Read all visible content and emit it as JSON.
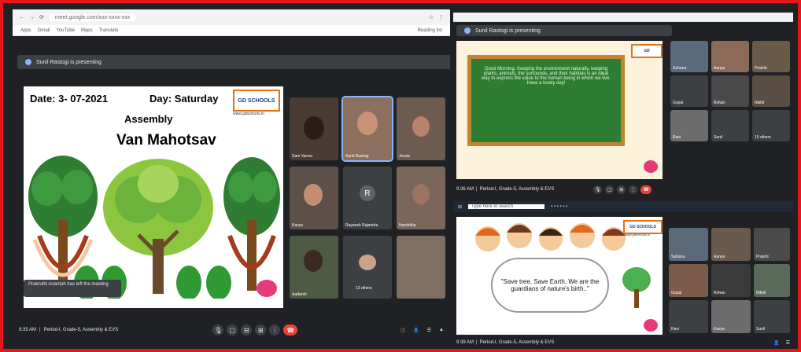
{
  "left_window": {
    "url": "meet.google.com/xxx-xxxx-xxx",
    "bookmarks": [
      "Apps",
      "Gmail",
      "YouTube",
      "Maps",
      "Translate"
    ],
    "reading_list": "Reading list",
    "presenting_text": "Sunil Rastogi is presenting",
    "slide": {
      "date": "Date: 3- 07-2021",
      "day": "Day: Saturday",
      "assembly": "Assembly",
      "title": "Van Mahotsav",
      "logo": "GD SCHOOLS",
      "website": "www.gdschools.in"
    },
    "toast": "Prakruthi Anantah has left the meeting",
    "participants": [
      {
        "name": "Sam Varma"
      },
      {
        "name": "Sunil Rastogi"
      },
      {
        "name": "Jessie"
      },
      {
        "name": "Kavya"
      },
      {
        "name": "Rayansh Rajendra",
        "initial": "R"
      },
      {
        "name": "Harshitha"
      },
      {
        "name": "Aadarsh"
      },
      {
        "name": "13 others"
      },
      {
        "name": ""
      }
    ],
    "meeting_time": "9:35 AM",
    "meeting_title": "Period-I, Grade-5, Assembly & EVS"
  },
  "right_top": {
    "presenting_text": "Sunil Rastogi is presenting",
    "board_text": "Good Morning. Keeping the environment naturally, keeping plants, animals, the surrounds, and their habitats is an ideal way to express the value to the human being in which we live. Have a lovely day!",
    "meeting_time": "9:36 AM",
    "meeting_title": "Period-I, Grade-5, Assembly & EVS",
    "search_placeholder": "Type here to search",
    "tiles": [
      "Suhana",
      "Aanya",
      "Prakriti",
      "Gopal",
      "Rohan",
      "Nikhil",
      "Ravi",
      "Sunil",
      "10 others",
      "Aadarsh"
    ]
  },
  "right_bottom": {
    "quote": "\"Save tree, Save Earth, We are the guardians of nature's birth..\"",
    "logo": "GD SCHOOLS",
    "website": "www.gdschools.in",
    "meeting_time": "9:39 AM",
    "meeting_title": "Period-I, Grade-5, Assembly & EVS",
    "tiles": [
      "Suhana",
      "Aanya",
      "Prakriti",
      "Gopal",
      "Rohan",
      "Nikhil",
      "Ravi",
      "Kavya",
      "Sunil",
      "10 others"
    ]
  },
  "colors": {
    "border": "#e8141c",
    "meet_bg": "#202124",
    "end_call": "#ea4335",
    "board": "#2e7d32"
  }
}
